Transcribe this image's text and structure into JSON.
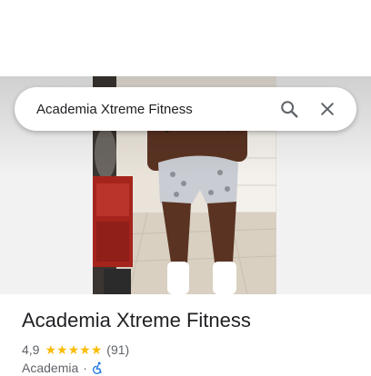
{
  "search": {
    "value": "Academia Xtreme Fitness",
    "search_icon": "search-icon",
    "clear_icon": "close-icon"
  },
  "place": {
    "title": "Academia Xtreme Fitness",
    "rating": "4,9",
    "rating_stars_filled": 5,
    "review_count": "(91)",
    "category": "Academia",
    "separator": "·",
    "accessibility_icon": "wheelchair-accessible-icon"
  },
  "colors": {
    "star": "#fbbc04",
    "accessibility": "#1a73e8",
    "title": "#202124",
    "secondary_text": "#5f6368"
  }
}
